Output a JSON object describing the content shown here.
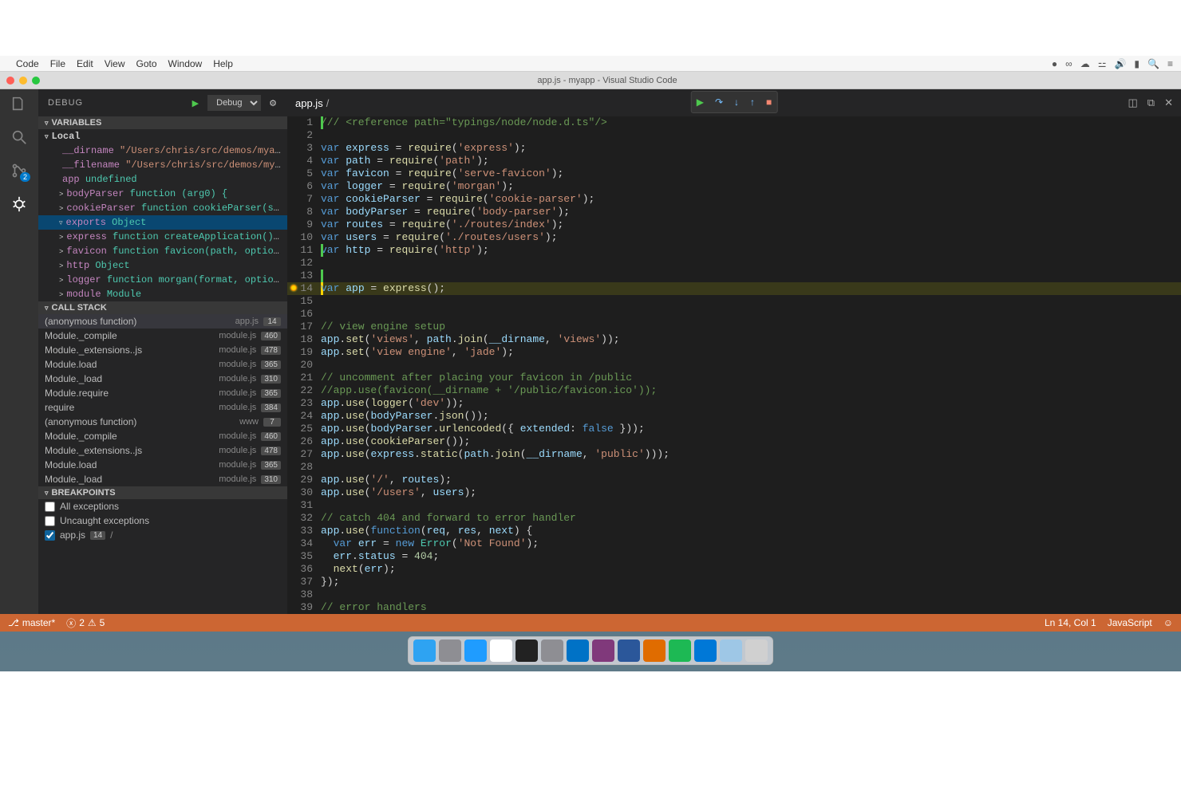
{
  "menubar": {
    "items": [
      "Code",
      "File",
      "Edit",
      "View",
      "Goto",
      "Window",
      "Help"
    ]
  },
  "window": {
    "title": "app.js - myapp - Visual Studio Code"
  },
  "activitybar": {
    "git_badge": "2"
  },
  "sidebar": {
    "title": "DEBUG",
    "config": "Debug",
    "sections": {
      "variables": "VARIABLES",
      "callstack": "CALL STACK",
      "breakpoints": "BREAKPOINTS"
    },
    "local_label": "Local",
    "vars": [
      {
        "expand": " ",
        "name": "__dirname",
        "value": "\"/Users/chris/src/demos/myapp\"",
        "kind": "str"
      },
      {
        "expand": " ",
        "name": "__filename",
        "value": "\"/Users/chris/src/demos/myapp…",
        "kind": "str"
      },
      {
        "expand": " ",
        "name": "app",
        "value": "undefined",
        "kind": "type"
      },
      {
        "expand": ">",
        "name": "bodyParser",
        "value": "function (arg0) {",
        "kind": "type"
      },
      {
        "expand": ">",
        "name": "cookieParser",
        "value": "function cookieParser(secre…",
        "kind": "type"
      },
      {
        "expand": "▿",
        "name": "exports",
        "value": "Object",
        "kind": "type",
        "selected": true
      },
      {
        "expand": ">",
        "name": "express",
        "value": "function createApplication() {",
        "kind": "type"
      },
      {
        "expand": ">",
        "name": "favicon",
        "value": "function favicon(path, options){",
        "kind": "type"
      },
      {
        "expand": ">",
        "name": "http",
        "value": "Object",
        "kind": "type"
      },
      {
        "expand": ">",
        "name": "logger",
        "value": "function morgan(format, options) {",
        "kind": "type"
      },
      {
        "expand": ">",
        "name": "module",
        "value": "Module",
        "kind": "type"
      }
    ],
    "callstack": [
      {
        "fn": "(anonymous function)",
        "file": "app.js",
        "line": "14",
        "selected": true
      },
      {
        "fn": "Module._compile",
        "file": "module.js",
        "line": "460"
      },
      {
        "fn": "Module._extensions..js",
        "file": "module.js",
        "line": "478"
      },
      {
        "fn": "Module.load",
        "file": "module.js",
        "line": "365"
      },
      {
        "fn": "Module._load",
        "file": "module.js",
        "line": "310"
      },
      {
        "fn": "Module.require",
        "file": "module.js",
        "line": "365"
      },
      {
        "fn": "require",
        "file": "module.js",
        "line": "384"
      },
      {
        "fn": "(anonymous function)",
        "file": "www",
        "line": "7"
      },
      {
        "fn": "Module._compile",
        "file": "module.js",
        "line": "460"
      },
      {
        "fn": "Module._extensions..js",
        "file": "module.js",
        "line": "478"
      },
      {
        "fn": "Module.load",
        "file": "module.js",
        "line": "365"
      },
      {
        "fn": "Module._load",
        "file": "module.js",
        "line": "310"
      }
    ],
    "breakpoints": [
      {
        "checked": false,
        "label": "All exceptions"
      },
      {
        "checked": false,
        "label": "Uncaught exceptions"
      },
      {
        "checked": true,
        "label": "app.js",
        "line": "14",
        "extra": "/"
      }
    ]
  },
  "editor": {
    "tab": "app.js",
    "dirty": "/",
    "current_line": 14,
    "lines": [
      {
        "n": 1,
        "html": "<span class='cmt'>/// &lt;reference path=\"typings/node/node.d.ts\"/&gt;</span>",
        "greenbar": true
      },
      {
        "n": 2,
        "html": ""
      },
      {
        "n": 3,
        "html": "<span class='kw'>var</span> <span class='ident'>express</span> = <span class='fnname'>require</span>(<span class='str'>'express'</span>);"
      },
      {
        "n": 4,
        "html": "<span class='kw'>var</span> <span class='ident'>path</span> = <span class='fnname'>require</span>(<span class='str'>'path'</span>);"
      },
      {
        "n": 5,
        "html": "<span class='kw'>var</span> <span class='ident'>favicon</span> = <span class='fnname'>require</span>(<span class='str'>'serve-favicon'</span>);"
      },
      {
        "n": 6,
        "html": "<span class='kw'>var</span> <span class='ident'>logger</span> = <span class='fnname'>require</span>(<span class='str'>'morgan'</span>);"
      },
      {
        "n": 7,
        "html": "<span class='kw'>var</span> <span class='ident'>cookieParser</span> = <span class='fnname'>require</span>(<span class='str'>'cookie-parser'</span>);"
      },
      {
        "n": 8,
        "html": "<span class='kw'>var</span> <span class='ident'>bodyParser</span> = <span class='fnname'>require</span>(<span class='str'>'body-parser'</span>);"
      },
      {
        "n": 9,
        "html": "<span class='kw'>var</span> <span class='ident'>routes</span> = <span class='fnname'>require</span>(<span class='str'>'./routes/index'</span>);"
      },
      {
        "n": 10,
        "html": "<span class='kw'>var</span> <span class='ident'>users</span> = <span class='fnname'>require</span>(<span class='str'>'./routes/users'</span>);"
      },
      {
        "n": 11,
        "html": "<span class='kw'>var</span> <span class='ident'>http</span> = <span class='fnname'>require</span>(<span class='str'>'http'</span>);",
        "greenbar": true
      },
      {
        "n": 12,
        "html": ""
      },
      {
        "n": 13,
        "html": "",
        "greenbar": true
      },
      {
        "n": 14,
        "html": "<span class='kw'>var</span> <span class='ident'>app</span> = <span class='fnname'>express</span>();",
        "highlight": true,
        "bp": true
      },
      {
        "n": 15,
        "html": ""
      },
      {
        "n": 16,
        "html": ""
      },
      {
        "n": 17,
        "html": "<span class='cmt'>// view engine setup</span>"
      },
      {
        "n": 18,
        "html": "<span class='ident'>app</span>.<span class='fnname'>set</span>(<span class='str'>'views'</span>, <span class='ident'>path</span>.<span class='fnname'>join</span>(<span class='ident'>__dirname</span>, <span class='str'>'views'</span>));"
      },
      {
        "n": 19,
        "html": "<span class='ident'>app</span>.<span class='fnname'>set</span>(<span class='str'>'view engine'</span>, <span class='str'>'jade'</span>);"
      },
      {
        "n": 20,
        "html": ""
      },
      {
        "n": 21,
        "html": "<span class='cmt'>// uncomment after placing your favicon in /public</span>"
      },
      {
        "n": 22,
        "html": "<span class='cmt'>//app.use(favicon(__dirname + '/public/favicon.ico'));</span>"
      },
      {
        "n": 23,
        "html": "<span class='ident'>app</span>.<span class='fnname'>use</span>(<span class='fnname'>logger</span>(<span class='str'>'dev'</span>));"
      },
      {
        "n": 24,
        "html": "<span class='ident'>app</span>.<span class='fnname'>use</span>(<span class='ident'>bodyParser</span>.<span class='fnname'>json</span>());"
      },
      {
        "n": 25,
        "html": "<span class='ident'>app</span>.<span class='fnname'>use</span>(<span class='ident'>bodyParser</span>.<span class='fnname'>urlencoded</span>({ <span class='ident'>extended</span>: <span class='const'>false</span> }));"
      },
      {
        "n": 26,
        "html": "<span class='ident'>app</span>.<span class='fnname'>use</span>(<span class='fnname'>cookieParser</span>());"
      },
      {
        "n": 27,
        "html": "<span class='ident'>app</span>.<span class='fnname'>use</span>(<span class='ident'>express</span>.<span class='fnname'>static</span>(<span class='ident'>path</span>.<span class='fnname'>join</span>(<span class='ident'>__dirname</span>, <span class='str'>'public'</span>)));"
      },
      {
        "n": 28,
        "html": ""
      },
      {
        "n": 29,
        "html": "<span class='ident'>app</span>.<span class='fnname'>use</span>(<span class='str'>'/'</span>, <span class='ident'>routes</span>);"
      },
      {
        "n": 30,
        "html": "<span class='ident'>app</span>.<span class='fnname'>use</span>(<span class='str'>'/users'</span>, <span class='ident'>users</span>);"
      },
      {
        "n": 31,
        "html": ""
      },
      {
        "n": 32,
        "html": "<span class='cmt'>// catch 404 and forward to error handler</span>"
      },
      {
        "n": 33,
        "html": "<span class='ident'>app</span>.<span class='fnname'>use</span>(<span class='kw'>function</span>(<span class='ident'>req</span>, <span class='ident'>res</span>, <span class='ident'>next</span>) {"
      },
      {
        "n": 34,
        "html": "  <span class='kw'>var</span> <span class='ident'>err</span> = <span class='kw'>new</span> <span class='type'>Error</span>(<span class='str'>'Not Found'</span>);"
      },
      {
        "n": 35,
        "html": "  <span class='ident'>err</span>.<span class='ident'>status</span> = <span class='num'>404</span>;"
      },
      {
        "n": 36,
        "html": "  <span class='fnname'>next</span>(<span class='ident'>err</span>);"
      },
      {
        "n": 37,
        "html": "});"
      },
      {
        "n": 38,
        "html": ""
      },
      {
        "n": 39,
        "html": "<span class='cmt'>// error handlers</span>"
      }
    ]
  },
  "statusbar": {
    "branch": "master*",
    "errors": "2",
    "warnings": "5",
    "position": "Ln 14, Col 1",
    "language": "JavaScript"
  },
  "dock": {
    "icons": [
      "finder",
      "launchpad",
      "safari",
      "chrome",
      "terminal",
      "settings",
      "outlook",
      "onenote",
      "word",
      "apps",
      "spotify",
      "vscode",
      "folder-trash",
      "trash"
    ]
  }
}
